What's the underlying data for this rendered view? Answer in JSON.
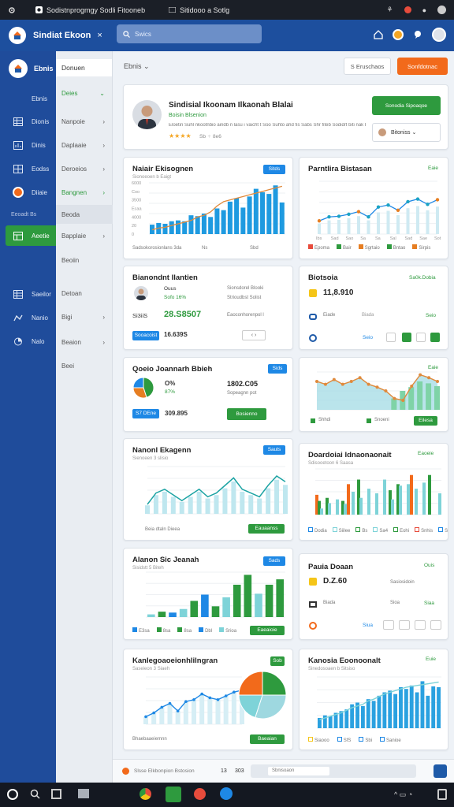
{
  "topbar": {
    "title1": "Sodistnprogmgy Sodli Fitooneb",
    "title2": "Sitidooo a Sotlg"
  },
  "appbar": {
    "title": "Sindiat Ekoon",
    "close": "×",
    "search_placeholder": "Swics"
  },
  "sidebar": {
    "brand": "Ebnis",
    "items": [
      {
        "label": "Ebnis",
        "icon": "none"
      },
      {
        "label": "Dionis",
        "icon": "table-icon"
      },
      {
        "label": "Dinis",
        "icon": "chart-icon"
      },
      {
        "label": "Eodss",
        "icon": "grid-icon"
      },
      {
        "label": "Diiaie",
        "icon": "avatar-icon"
      },
      {
        "label": "Eeoadt Bs",
        "icon": "none"
      },
      {
        "label": "Aeetie",
        "icon": "layout-icon"
      },
      {
        "label": "Saeilor",
        "icon": "table-icon"
      },
      {
        "label": "Nanio",
        "icon": "flow-icon"
      },
      {
        "label": "Nalo",
        "icon": "pie-icon"
      }
    ]
  },
  "subnav": {
    "header": "Donuen",
    "items": [
      {
        "label": "Deies",
        "chev": "⌄"
      },
      {
        "label": "Nanpoie",
        "chev": "›"
      },
      {
        "label": "Daplaaie",
        "chev": "›"
      },
      {
        "label": "Deroeios",
        "chev": "›"
      },
      {
        "label": "Bangnen",
        "chev": "›"
      },
      {
        "label": "Beoda",
        "chev": ""
      },
      {
        "label": "Bapplaie",
        "chev": "›"
      },
      {
        "label": "Beoiin",
        "chev": ""
      },
      {
        "label": "Detoan",
        "chev": ""
      },
      {
        "label": "Bigi",
        "chev": "›"
      },
      {
        "label": "Beaion",
        "chev": "›"
      },
      {
        "label": "Beei",
        "chev": ""
      }
    ]
  },
  "main_header": {
    "crumb": "Ebnis ⌄",
    "btn1": "S Eruschaos",
    "btn2": "Sonfdotnac"
  },
  "profile": {
    "name": "Sindisial Ikoonam Ilkaonah Blalai",
    "role": "Boisin Blsenion",
    "desc": "Eloetin Suhl nkootnbio aindb n lasu i vaicht t Soo Suhto ahd fis  Sabs Shr fiteb Sodidrt biti  nak Bia",
    "rating": "★★★★",
    "rating_meta": "Sb  ⁘ 8e6",
    "cta": "Sonodia Sipoaqoe",
    "user_select": "Bitoniss ⌄"
  },
  "cards": {
    "c1": {
      "title": "Naiair Ekisognen",
      "sub": "Sionoeoen b Eaigt",
      "pill": "Sitds",
      "foot1": "Sadsokorosionlans 3da",
      "foot2": "Ns",
      "foot3": "Sbd"
    },
    "c2": {
      "title": "Parntlira Bistasan",
      "value": "Eaie",
      "legend": [
        "Epoma",
        "Bair",
        "Sgrtaio",
        "Bntao",
        "Sirpis"
      ]
    },
    "c3": {
      "title": "Bianondnt Ilantien",
      "percent": "Ouus",
      "percent2": "Sofo 16%",
      "metric_label": "Sionsdorel Blooki",
      "metric_label2": "Strioudbst Solist",
      "stat1": "Si3iiS",
      "stat2": "28.S8507",
      "metric_label3": "Eaoconhorenpol l",
      "btn": "Sooacoist",
      "value": "16.639S",
      "stepper": "‹  ›"
    },
    "c4": {
      "title": "Biotsoia",
      "value": "Sa0k.Dobia",
      "amount": "11,8.910",
      "r1": "Eiade",
      "r2": "Biada",
      "r3": "Seio"
    },
    "c5": {
      "title": "Qoeio Joannarh Bbieh",
      "sub": "Sisinoeos ayad",
      "pill": "Sids",
      "percent": "O%",
      "percent2": "87%",
      "amount": "1802.C05",
      "amount_sub": "Sopeagnn pot",
      "btn_left": "S7 DEne",
      "value": "309.895",
      "btn_right": "Bosienno"
    },
    "c6": {
      "title": "",
      "value": "Eaie",
      "leg1": "Shhdi",
      "leg2": "Snoeni",
      "leg3": "Eilesa"
    },
    "c7": {
      "title": "Nanonl Ekagenn",
      "sub": "Sienoeen 3 slisio",
      "pill": "Sauts",
      "foot": "Beia dtaln Dieea",
      "btn": "Eauaanss"
    },
    "c8": {
      "title": "Doardoiai ldnaonaonait",
      "sub": "Sdisooetoon 6 Saasa",
      "value": "Eaoeie",
      "leg": [
        "Dodia",
        "Siilee",
        "Bs",
        "Sa4",
        "Eohi",
        "Snhis",
        "Sbuuooe"
      ]
    },
    "c9": {
      "title": "Alanon Sic Jeanah",
      "sub": "Sisidstt 5 Biteh",
      "pill": "Sads",
      "leg": [
        "E3sa",
        "8sa",
        "8sa",
        "Dbl",
        "Srioa"
      ],
      "btn": "Eaeaioie"
    },
    "c10": {
      "title": "Pauia Doaan",
      "value": "Ouis",
      "amount": "D.Z.60",
      "amount_sub": "Sasiosidoin",
      "r1": "Biada",
      "r2": "Sioa",
      "r2v": "Siaa",
      "r3v": "Siua"
    },
    "c11": {
      "title": "Kanlegoaoeionhlilngran",
      "sub": "Saseieon 3 Siaeh",
      "pill": "Sob",
      "foot": "Bhaebaaeiemnn",
      "btn": "Baeaian"
    },
    "c12": {
      "title": "Kanosia Eoonoonalt",
      "sub": "Sinedosoaen b Sitsiso",
      "value": "Euie",
      "leg": [
        "Siaooo",
        "SfS",
        "Sbi",
        "Sanioe"
      ]
    }
  },
  "bottom": {
    "app": "Slsse Elkbonpion Bstosion",
    "count": "13",
    "count2": "303",
    "search": "Sbnisoaon"
  },
  "chart_data": [
    {
      "type": "bar",
      "name": "c1",
      "series": [
        {
          "name": "bars",
          "values": [
            11,
            13,
            12,
            15,
            16,
            15,
            22,
            21,
            24,
            20,
            30,
            28,
            38,
            42,
            31,
            44,
            53,
            49,
            47,
            57,
            37
          ]
        }
      ],
      "line": [
        5,
        7,
        8,
        10,
        12,
        14,
        16,
        20,
        22,
        26,
        33,
        38,
        40,
        42,
        44,
        46,
        48,
        50,
        52,
        54,
        56
      ],
      "ylim": [
        0,
        60
      ],
      "yticks": [
        "6000",
        "Coo",
        "3500",
        "Ecaa",
        "4000",
        "20",
        "0"
      ]
    },
    {
      "type": "line",
      "name": "c2",
      "x": [
        "Ibs",
        "Sad",
        "Sao",
        "Sa",
        "Sa",
        "Sal",
        "Sad",
        "Sae",
        "Sot"
      ],
      "series": [
        {
          "name": "line",
          "values": [
            20,
            26,
            27,
            30,
            34,
            26,
            41,
            44,
            36,
            49,
            53,
            45,
            52
          ]
        }
      ],
      "ylim": [
        0,
        80
      ]
    },
    {
      "type": "pie",
      "name": "c5",
      "values": [
        45,
        30,
        25
      ],
      "colors": [
        "#2e9a3e",
        "#e67e22",
        "#1e88e5"
      ]
    },
    {
      "type": "area",
      "name": "c6",
      "series": [
        {
          "name": "line",
          "values": [
            30,
            27,
            32,
            27,
            30,
            34,
            27,
            24,
            20,
            12,
            10,
            25,
            37,
            34,
            30
          ]
        }
      ],
      "bars": [
        0,
        0,
        0,
        0,
        0,
        0,
        0,
        0,
        0,
        12,
        20,
        24,
        30,
        28,
        25
      ],
      "ylim": [
        0,
        40
      ]
    },
    {
      "type": "line",
      "name": "c7",
      "series": [
        {
          "name": "line",
          "values": [
            10,
            22,
            26,
            20,
            14,
            20,
            26,
            18,
            22,
            30,
            38,
            26,
            22,
            18,
            30,
            40,
            34
          ]
        }
      ],
      "ylim": [
        0,
        50
      ]
    },
    {
      "type": "bar",
      "name": "c8",
      "series": [
        {
          "name": "orange",
          "values": [
            26,
            0,
            0,
            0,
            40,
            0,
            0,
            0,
            0,
            0,
            0,
            0,
            52,
            0,
            0,
            0
          ]
        },
        {
          "name": "green",
          "values": [
            18,
            22,
            0,
            18,
            0,
            46,
            0,
            0,
            0,
            32,
            40,
            0,
            0,
            0,
            52,
            0
          ]
        },
        {
          "name": "teal",
          "values": [
            8,
            15,
            20,
            14,
            30,
            22,
            34,
            28,
            46,
            20,
            38,
            40,
            34,
            42,
            0,
            28
          ]
        }
      ],
      "ylim": [
        0,
        60
      ]
    },
    {
      "type": "bar",
      "name": "c9",
      "values": [
        3,
        6,
        5,
        9,
        18,
        25,
        12,
        22,
        36,
        47,
        26,
        36,
        42
      ],
      "ylim": [
        0,
        50
      ]
    },
    {
      "type": "area",
      "name": "c11",
      "series": [
        {
          "name": "line",
          "values": [
            8,
            12,
            18,
            22,
            14,
            24,
            26,
            32,
            28,
            26,
            30,
            34,
            36
          ]
        }
      ],
      "ylim": [
        0,
        50
      ]
    },
    {
      "type": "bar",
      "name": "c12",
      "values": [
        12,
        15,
        14,
        18,
        20,
        22,
        28,
        30,
        26,
        34,
        32,
        38,
        42,
        44,
        40,
        48,
        46,
        50,
        42,
        55,
        38,
        49,
        48
      ],
      "line": [
        10,
        12,
        14,
        16,
        18,
        21,
        24,
        26,
        28,
        32,
        34,
        37,
        40,
        42,
        44,
        46,
        48,
        49,
        50,
        51,
        52,
        53,
        54
      ],
      "ylim": [
        0,
        60
      ]
    }
  ],
  "colors": {
    "primary": "#1d4f9e",
    "accent": "#1e88e5",
    "green": "#2e9a3e",
    "orange": "#f26a1b",
    "teal": "#7ed3d8"
  }
}
